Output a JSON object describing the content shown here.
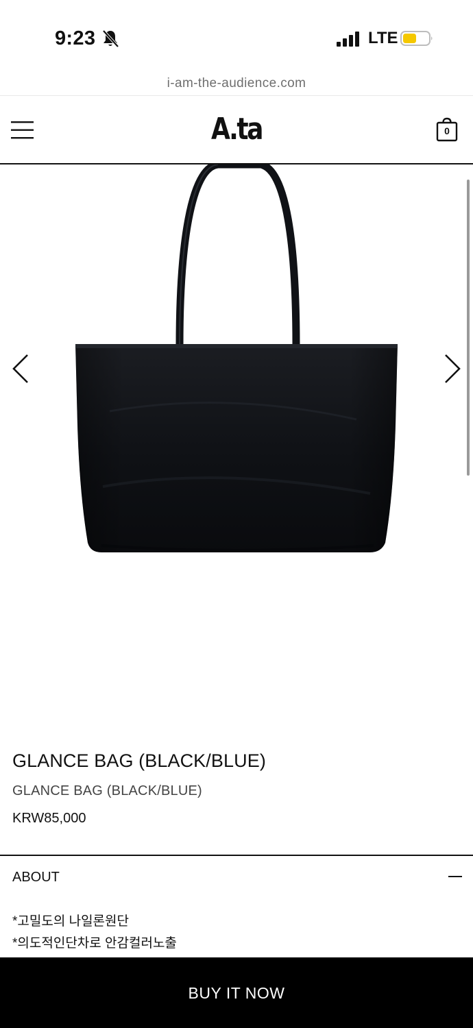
{
  "status_bar": {
    "time": "9:23",
    "network": "LTE",
    "icons": [
      "bell-slash-icon",
      "cellular-signal-icon",
      "battery-icon"
    ],
    "battery_color": "#f5c800"
  },
  "browser": {
    "url": "i-am-the-audience.com"
  },
  "header": {
    "logo": "A.ta",
    "cart_count": "0",
    "icons": [
      "hamburger-menu-icon",
      "shopping-bag-icon"
    ]
  },
  "gallery": {
    "image_description_icon": "tote-bag-image",
    "prev_icon": "chevron-left-icon",
    "next_icon": "chevron-right-icon"
  },
  "product": {
    "title": "GLANCE BAG (BLACK/BLUE)",
    "subtitle": "GLANCE BAG (BLACK/BLUE)",
    "price": "KRW85,000"
  },
  "about": {
    "label": "ABOUT",
    "lines": [
      "*고밀도의 나일론원단",
      "*의도적인단차로 안감컬러노출"
    ]
  },
  "actions": {
    "buy_label": "BUY IT NOW"
  },
  "colors": {
    "accent": "#000000",
    "background": "#ffffff",
    "url_text": "#6e6e6e"
  }
}
